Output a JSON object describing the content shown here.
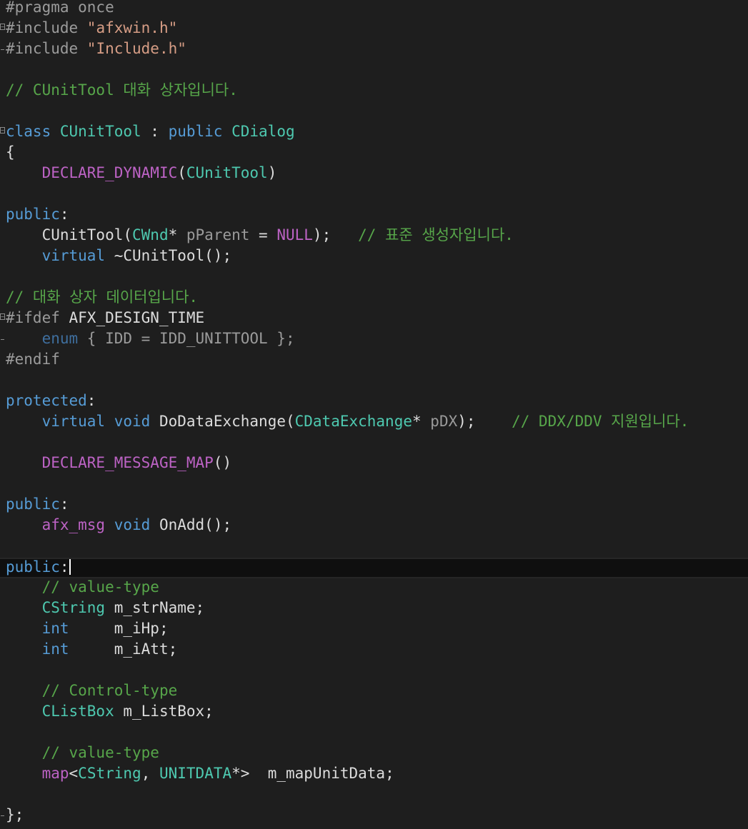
{
  "editor": {
    "file_language": "C++",
    "theme": {
      "background": "#1e1e1e",
      "current_line": "#0f0f0f",
      "plain": "#dcdcdc",
      "preprocessor": "#9b9b9b",
      "string": "#d69d85",
      "comment": "#57a64a",
      "keyword": "#569cd6",
      "type": "#4ec9b0",
      "macro": "#bd63c5",
      "parameter": "#9a9a9a"
    },
    "current_line_index": 27,
    "lines": [
      {
        "fold": "",
        "tokens": [
          {
            "t": "#pragma once",
            "c": "pre"
          }
        ]
      },
      {
        "fold": "open",
        "tokens": [
          {
            "t": "#include ",
            "c": "pre"
          },
          {
            "t": "\"afxwin.h\"",
            "c": "str"
          }
        ]
      },
      {
        "fold": "end",
        "tokens": [
          {
            "t": "#include ",
            "c": "pre"
          },
          {
            "t": "\"Include.h\"",
            "c": "str"
          }
        ]
      },
      {
        "fold": "",
        "tokens": []
      },
      {
        "fold": "",
        "tokens": [
          {
            "t": "// CUnitTool 대화 상자입니다.",
            "c": "com"
          }
        ]
      },
      {
        "fold": "",
        "tokens": []
      },
      {
        "fold": "open",
        "tokens": [
          {
            "t": "class ",
            "c": "kw"
          },
          {
            "t": "CUnitTool",
            "c": "type"
          },
          {
            "t": " : ",
            "c": "plain"
          },
          {
            "t": "public ",
            "c": "kw"
          },
          {
            "t": "CDialog",
            "c": "type"
          }
        ]
      },
      {
        "fold": "",
        "tokens": [
          {
            "t": "{",
            "c": "plain"
          }
        ]
      },
      {
        "fold": "",
        "tokens": [
          {
            "t": "    ",
            "c": "plain"
          },
          {
            "t": "DECLARE_DYNAMIC",
            "c": "mac"
          },
          {
            "t": "(",
            "c": "plain"
          },
          {
            "t": "CUnitTool",
            "c": "type"
          },
          {
            "t": ")",
            "c": "plain"
          }
        ]
      },
      {
        "fold": "",
        "tokens": []
      },
      {
        "fold": "",
        "tokens": [
          {
            "t": "public",
            "c": "kw"
          },
          {
            "t": ":",
            "c": "plain"
          }
        ]
      },
      {
        "fold": "",
        "tokens": [
          {
            "t": "    CUnitTool(",
            "c": "plain"
          },
          {
            "t": "CWnd",
            "c": "type"
          },
          {
            "t": "* ",
            "c": "plain"
          },
          {
            "t": "pParent",
            "c": "param"
          },
          {
            "t": " = ",
            "c": "plain"
          },
          {
            "t": "NULL",
            "c": "mac"
          },
          {
            "t": ");   ",
            "c": "plain"
          },
          {
            "t": "// 표준 생성자입니다.",
            "c": "com"
          }
        ]
      },
      {
        "fold": "",
        "tokens": [
          {
            "t": "    ",
            "c": "plain"
          },
          {
            "t": "virtual",
            "c": "kw"
          },
          {
            "t": " ~CUnitTool();",
            "c": "plain"
          }
        ]
      },
      {
        "fold": "",
        "tokens": []
      },
      {
        "fold": "",
        "tokens": [
          {
            "t": "// 대화 상자 데이터입니다.",
            "c": "com"
          }
        ]
      },
      {
        "fold": "open",
        "tokens": [
          {
            "t": "#ifdef ",
            "c": "pre"
          },
          {
            "t": "AFX_DESIGN_TIME",
            "c": "plain"
          }
        ]
      },
      {
        "fold": "end",
        "tokens": [
          {
            "t": "    ",
            "c": "plain"
          },
          {
            "t": "enum",
            "c": "dimkw"
          },
          {
            "t": " { IDD = IDD_UNITTOOL };",
            "c": "dim"
          }
        ]
      },
      {
        "fold": "",
        "tokens": [
          {
            "t": "#endif",
            "c": "pre"
          }
        ]
      },
      {
        "fold": "",
        "tokens": []
      },
      {
        "fold": "",
        "tokens": [
          {
            "t": "protected",
            "c": "kw"
          },
          {
            "t": ":",
            "c": "plain"
          }
        ]
      },
      {
        "fold": "",
        "tokens": [
          {
            "t": "    ",
            "c": "plain"
          },
          {
            "t": "virtual",
            "c": "kw"
          },
          {
            "t": " ",
            "c": "plain"
          },
          {
            "t": "void",
            "c": "kw"
          },
          {
            "t": " DoDataExchange(",
            "c": "plain"
          },
          {
            "t": "CDataExchange",
            "c": "type"
          },
          {
            "t": "* ",
            "c": "plain"
          },
          {
            "t": "pDX",
            "c": "param"
          },
          {
            "t": ");    ",
            "c": "plain"
          },
          {
            "t": "// DDX/DDV 지원입니다.",
            "c": "com"
          }
        ]
      },
      {
        "fold": "",
        "tokens": []
      },
      {
        "fold": "",
        "tokens": [
          {
            "t": "    ",
            "c": "plain"
          },
          {
            "t": "DECLARE_MESSAGE_MAP",
            "c": "mac"
          },
          {
            "t": "()",
            "c": "plain"
          }
        ]
      },
      {
        "fold": "",
        "tokens": []
      },
      {
        "fold": "",
        "tokens": [
          {
            "t": "public",
            "c": "kw"
          },
          {
            "t": ":",
            "c": "plain"
          }
        ]
      },
      {
        "fold": "",
        "tokens": [
          {
            "t": "    ",
            "c": "plain"
          },
          {
            "t": "afx_msg",
            "c": "mac"
          },
          {
            "t": " ",
            "c": "plain"
          },
          {
            "t": "void",
            "c": "kw"
          },
          {
            "t": " OnAdd();",
            "c": "plain"
          }
        ]
      },
      {
        "fold": "",
        "tokens": []
      },
      {
        "fold": "",
        "tokens": [
          {
            "t": "public",
            "c": "kw"
          },
          {
            "t": ":",
            "c": "plain"
          }
        ]
      },
      {
        "fold": "",
        "tokens": [
          {
            "t": "    ",
            "c": "plain"
          },
          {
            "t": "// value-type",
            "c": "com"
          }
        ]
      },
      {
        "fold": "",
        "tokens": [
          {
            "t": "    ",
            "c": "plain"
          },
          {
            "t": "CString",
            "c": "type"
          },
          {
            "t": " m_strName;",
            "c": "plain"
          }
        ]
      },
      {
        "fold": "",
        "tokens": [
          {
            "t": "    ",
            "c": "plain"
          },
          {
            "t": "int",
            "c": "kw"
          },
          {
            "t": "     m_iHp;",
            "c": "plain"
          }
        ]
      },
      {
        "fold": "",
        "tokens": [
          {
            "t": "    ",
            "c": "plain"
          },
          {
            "t": "int",
            "c": "kw"
          },
          {
            "t": "     m_iAtt;",
            "c": "plain"
          }
        ]
      },
      {
        "fold": "",
        "tokens": []
      },
      {
        "fold": "",
        "tokens": [
          {
            "t": "    ",
            "c": "plain"
          },
          {
            "t": "// Control-type",
            "c": "com"
          }
        ]
      },
      {
        "fold": "",
        "tokens": [
          {
            "t": "    ",
            "c": "plain"
          },
          {
            "t": "CListBox",
            "c": "type"
          },
          {
            "t": " m_ListBox;",
            "c": "plain"
          }
        ]
      },
      {
        "fold": "",
        "tokens": []
      },
      {
        "fold": "",
        "tokens": [
          {
            "t": "    ",
            "c": "plain"
          },
          {
            "t": "// value-type",
            "c": "com"
          }
        ]
      },
      {
        "fold": "",
        "tokens": [
          {
            "t": "    ",
            "c": "plain"
          },
          {
            "t": "map",
            "c": "mac"
          },
          {
            "t": "<",
            "c": "plain"
          },
          {
            "t": "CString",
            "c": "type"
          },
          {
            "t": ", ",
            "c": "plain"
          },
          {
            "t": "UNITDATA",
            "c": "type"
          },
          {
            "t": "*>  m_mapUnitData;",
            "c": "plain"
          }
        ]
      },
      {
        "fold": "",
        "tokens": []
      },
      {
        "fold": "end",
        "tokens": [
          {
            "t": "};",
            "c": "plain"
          }
        ]
      }
    ]
  }
}
